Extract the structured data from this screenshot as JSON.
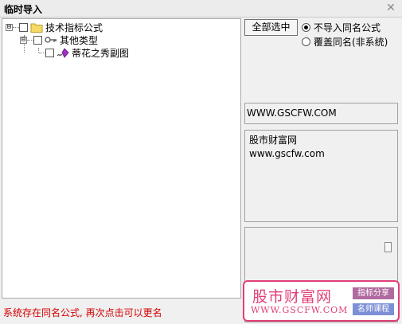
{
  "window": {
    "title": "临时导入",
    "close_glyph": "✕"
  },
  "tree": {
    "expander_glyph": "⊟",
    "nodes": [
      {
        "label": "技术指标公式",
        "icon": "folder-icon"
      },
      {
        "label": "其他类型",
        "icon": "key-icon"
      },
      {
        "label": "蒂花之秀副图",
        "icon": "formula-icon"
      }
    ]
  },
  "status": {
    "message": "系统存在同名公式, 再次点击可以更名",
    "color": "#d40000"
  },
  "options": {
    "select_all_label": "全部选中",
    "radio_skip_label": "不导入同名公式",
    "radio_skip_selected": true,
    "radio_overwrite_label": "覆盖同名(非系统)",
    "radio_overwrite_selected": false
  },
  "info": {
    "url": "WWW.GSCFW.COM",
    "site_name": "股市财富网",
    "site_url": "www.gscfw.com"
  },
  "watermark": {
    "brand": "股市财富网",
    "url": "WWW.GSCFW.COM",
    "tag1": "指标分享",
    "tag2": "名师课程",
    "color": "#e0407a"
  }
}
